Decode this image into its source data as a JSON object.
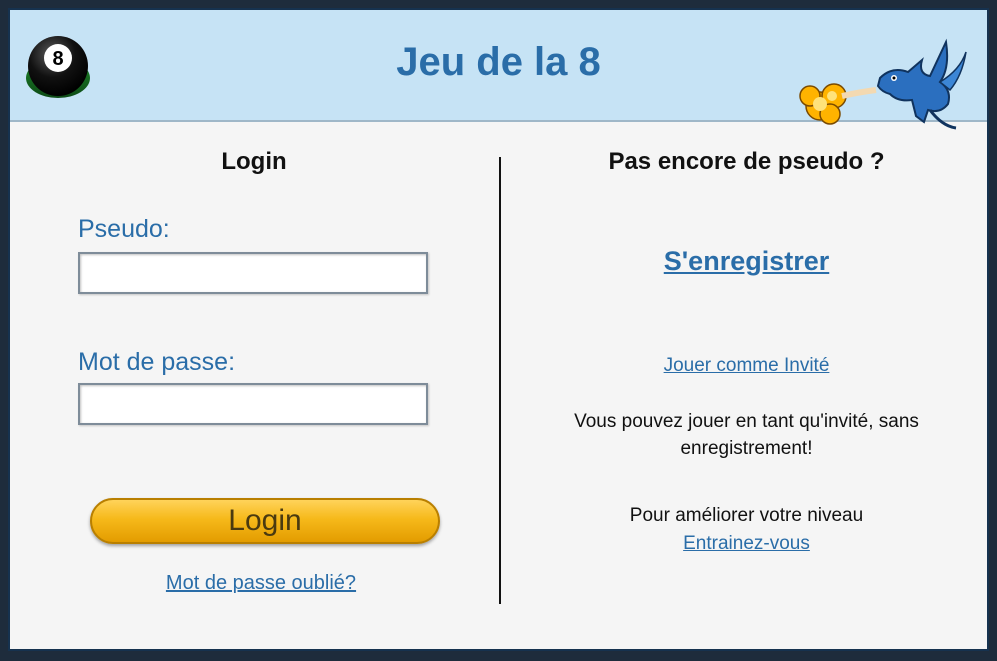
{
  "header": {
    "title": "Jeu de la 8"
  },
  "login": {
    "heading": "Login",
    "username_label": "Pseudo:",
    "username_value": "",
    "password_label": "Mot de passe:",
    "password_value": "",
    "button_label": "Login",
    "forgot_link": "Mot de passe oublié?"
  },
  "register": {
    "heading": "Pas encore de pseudo ?",
    "register_link": "S'enregistrer",
    "guest_link": "Jouer comme Invité",
    "guest_text": "Vous pouvez jouer en tant qu'invité, sans enregistrement!",
    "improve_text": "Pour améliorer votre niveau",
    "train_link": "Entrainez-vous"
  },
  "colors": {
    "accent": "#2a6da8",
    "header_bg": "#c6e3f5",
    "button": "#f6b91a"
  }
}
